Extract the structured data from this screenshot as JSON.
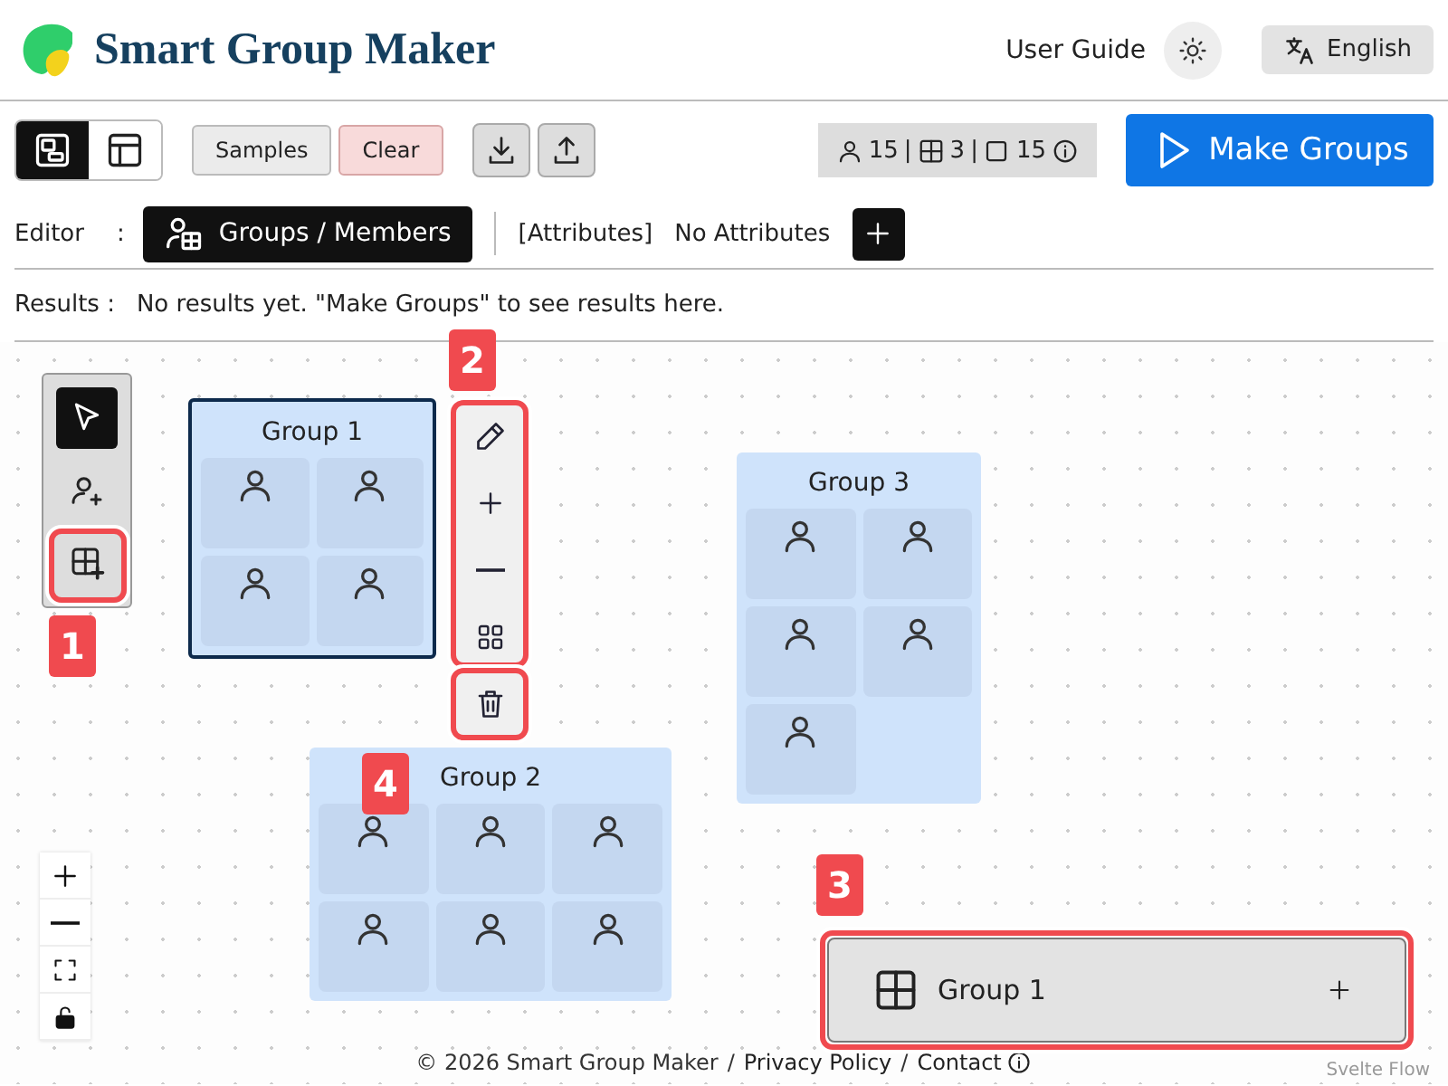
{
  "header": {
    "title": "Smart Group Maker",
    "user_guide": "User Guide",
    "language": "English"
  },
  "toolbar": {
    "views": [
      {
        "kind": "canvas",
        "selected": true
      },
      {
        "kind": "table",
        "selected": false
      }
    ],
    "samples": "Samples",
    "clear": "Clear",
    "stats": {
      "members": "15",
      "separator_1": "|",
      "groups": "3",
      "separator_2": "|",
      "seats": "15"
    },
    "make_groups": "Make Groups"
  },
  "editor": {
    "label": "Editor",
    "separator": ":",
    "tab": "Groups / Members",
    "attributes_label": "[Attributes]",
    "attributes_value": "No Attributes"
  },
  "results": {
    "label": "Results :",
    "message": "No results yet. \"Make Groups\" to see results here."
  },
  "canvas": {
    "tools": [
      {
        "kind": "select",
        "selected": true
      },
      {
        "kind": "add-member",
        "selected": false
      },
      {
        "kind": "add-group",
        "selected": false
      }
    ],
    "groups": [
      {
        "title": "Group 1",
        "selected": true,
        "members": [
          {
            "kind": "person"
          },
          {
            "kind": "person"
          },
          {
            "kind": "person"
          },
          {
            "kind": "person"
          }
        ]
      },
      {
        "title": "Group 2",
        "selected": false,
        "members": [
          {
            "kind": "person"
          },
          {
            "kind": "person"
          },
          {
            "kind": "person"
          },
          {
            "kind": "person"
          },
          {
            "kind": "person"
          },
          {
            "kind": "person"
          }
        ]
      },
      {
        "title": "Group 3",
        "selected": false,
        "members": [
          {
            "kind": "person"
          },
          {
            "kind": "person"
          },
          {
            "kind": "person"
          },
          {
            "kind": "person"
          },
          {
            "kind": "person"
          }
        ]
      }
    ],
    "node_toolbar": [
      {
        "kind": "edit"
      },
      {
        "kind": "add"
      },
      {
        "kind": "remove"
      },
      {
        "kind": "layout"
      },
      {
        "kind": "delete"
      }
    ],
    "zoom_controls": [
      {
        "kind": "zoom-in"
      },
      {
        "kind": "zoom-out"
      },
      {
        "kind": "fit"
      },
      {
        "kind": "lock"
      }
    ],
    "panel": {
      "title": "Group 1"
    },
    "attribution": "Svelte Flow"
  },
  "annotations": [
    {
      "label": "1"
    },
    {
      "label": "2"
    },
    {
      "label": "3"
    },
    {
      "label": "4"
    }
  ],
  "footer": {
    "copyright": "© 2026 Smart Group Maker",
    "separator_1": "/",
    "privacy": "Privacy Policy",
    "separator_2": "/",
    "contact": "Contact"
  }
}
